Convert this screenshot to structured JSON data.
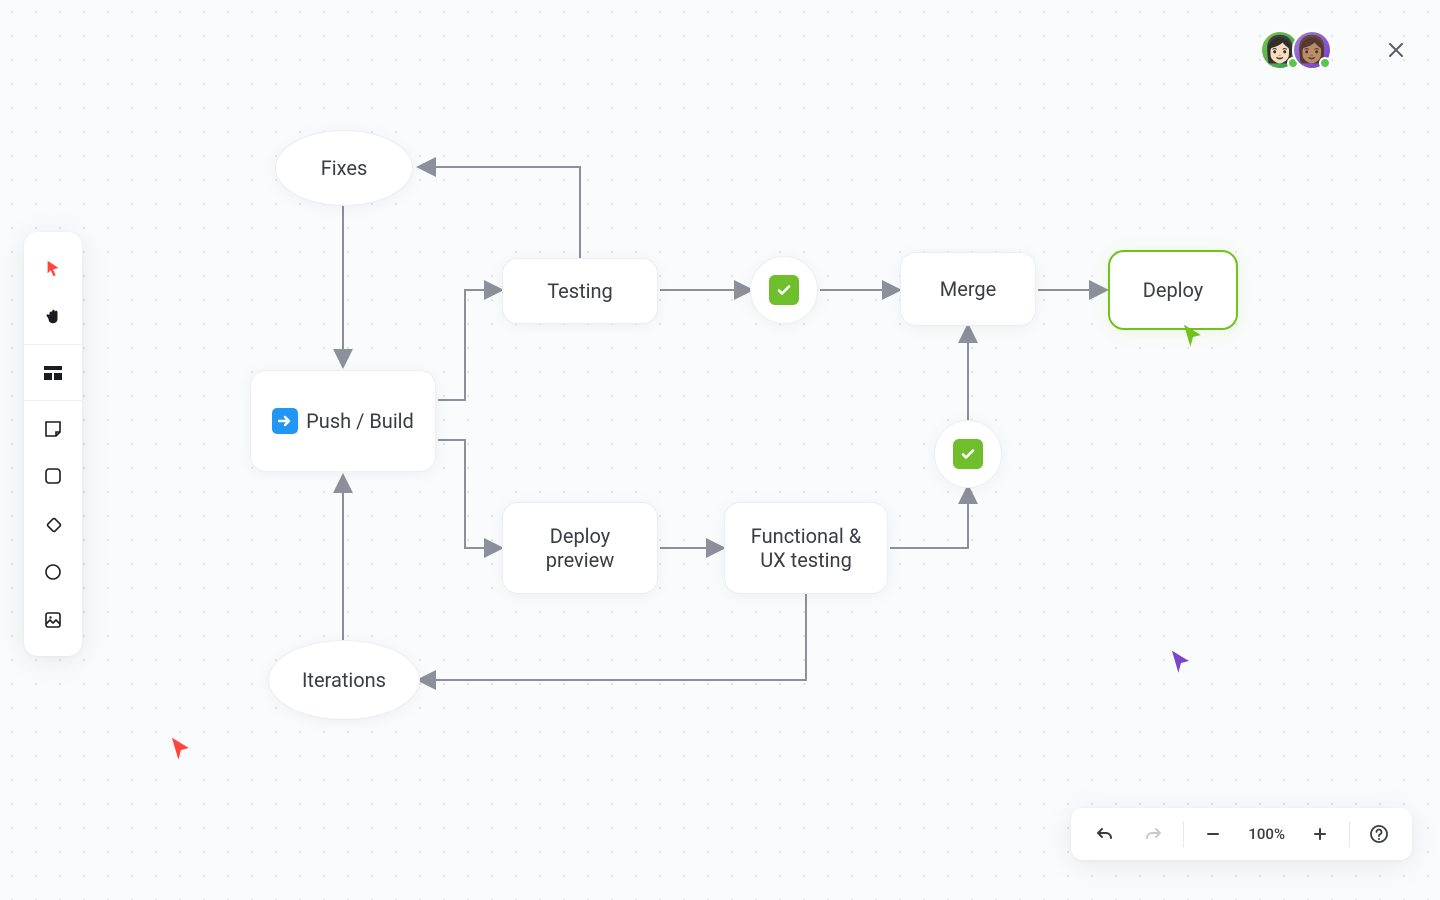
{
  "header": {
    "close_label": "Close"
  },
  "toolbox": {
    "cursor": "cursor",
    "hand": "hand",
    "section": "section",
    "sticky": "sticky",
    "rect": "rectangle",
    "diamond": "diamond",
    "circle": "circle",
    "image": "image"
  },
  "bottombar": {
    "zoom": "100%"
  },
  "nodes": {
    "fixes": "Fixes",
    "push_build": "Push / Build",
    "testing": "Testing",
    "deploy_preview_1": "Deploy",
    "deploy_preview_2": "preview",
    "functional_ux_1": "Functional &",
    "functional_ux_2": "UX testing",
    "merge": "Merge",
    "deploy": "Deploy",
    "iterations": "Iterations"
  },
  "collaborators": {
    "red": "#ff453a",
    "purple": "#7b46c9",
    "green": "#71c21a"
  },
  "diagram": {
    "type": "flowchart",
    "nodes": [
      {
        "id": "fixes",
        "label": "Fixes",
        "shape": "ellipse"
      },
      {
        "id": "push_build",
        "label": "Push / Build",
        "shape": "rect",
        "icon": "arrow-right-emoji"
      },
      {
        "id": "testing",
        "label": "Testing",
        "shape": "rect"
      },
      {
        "id": "check1",
        "label": "✓",
        "shape": "circle-check"
      },
      {
        "id": "merge",
        "label": "Merge",
        "shape": "rect"
      },
      {
        "id": "deploy",
        "label": "Deploy",
        "shape": "rect",
        "selected": true
      },
      {
        "id": "deploy_preview",
        "label": "Deploy preview",
        "shape": "rect"
      },
      {
        "id": "functional_ux",
        "label": "Functional & UX testing",
        "shape": "rect"
      },
      {
        "id": "check2",
        "label": "✓",
        "shape": "circle-check"
      },
      {
        "id": "iterations",
        "label": "Iterations",
        "shape": "ellipse"
      }
    ],
    "edges": [
      {
        "from": "fixes",
        "to": "push_build"
      },
      {
        "from": "push_build",
        "to": "testing"
      },
      {
        "from": "push_build",
        "to": "deploy_preview"
      },
      {
        "from": "testing",
        "to": "check1"
      },
      {
        "from": "testing",
        "to": "fixes"
      },
      {
        "from": "check1",
        "to": "merge"
      },
      {
        "from": "merge",
        "to": "deploy"
      },
      {
        "from": "deploy_preview",
        "to": "functional_ux"
      },
      {
        "from": "functional_ux",
        "to": "check2"
      },
      {
        "from": "functional_ux",
        "to": "iterations"
      },
      {
        "from": "check2",
        "to": "merge"
      },
      {
        "from": "iterations",
        "to": "push_build"
      }
    ]
  }
}
